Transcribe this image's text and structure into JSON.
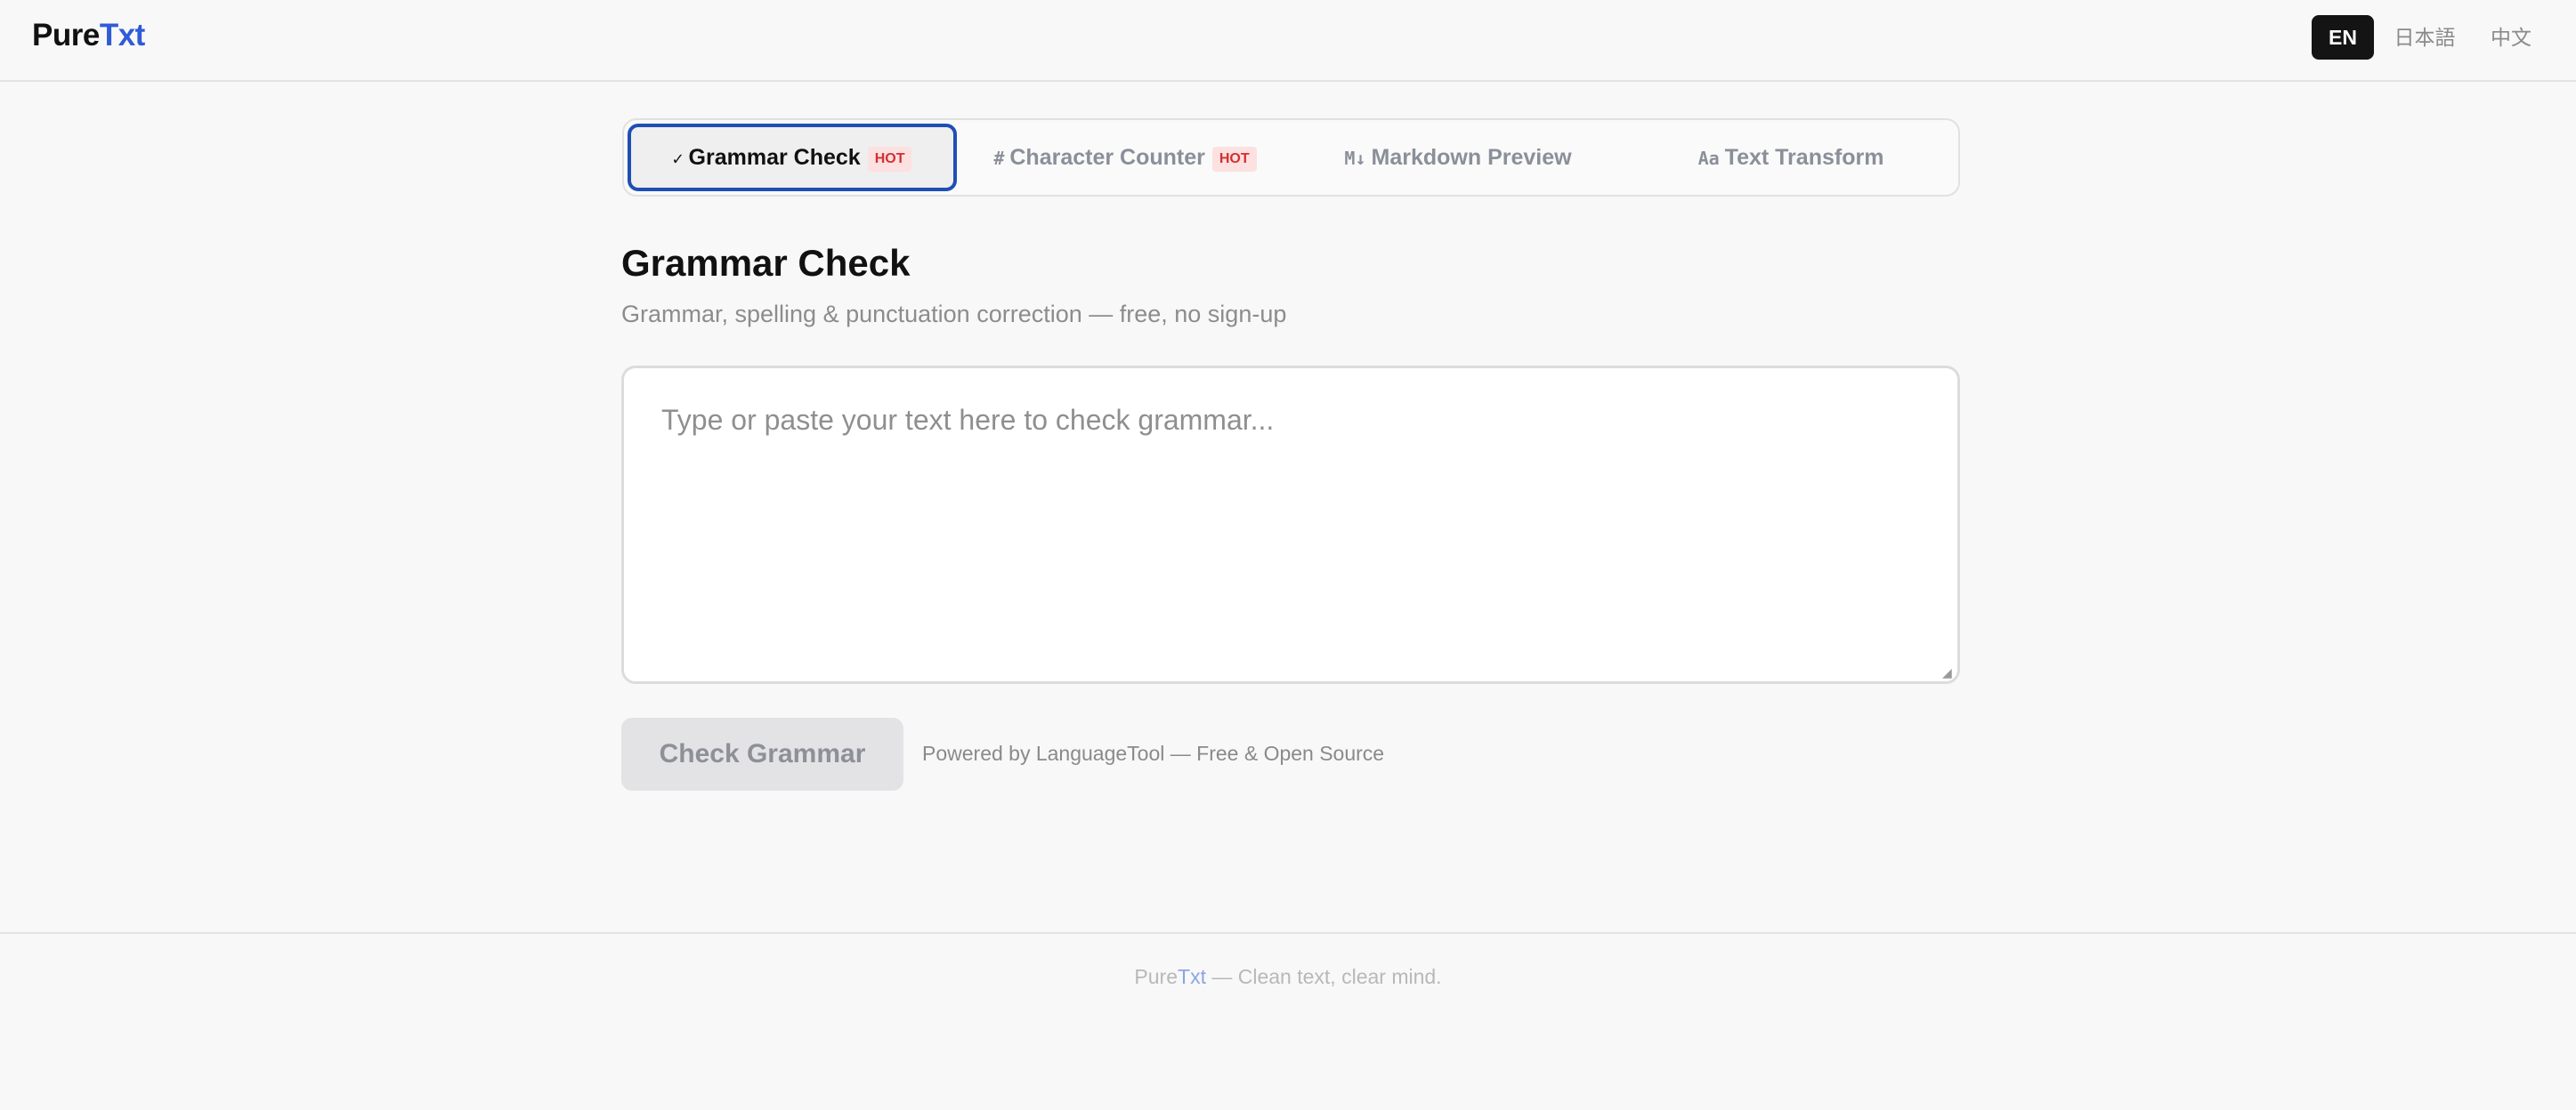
{
  "brand": {
    "part1": "Pure",
    "part2": "Txt"
  },
  "languages": [
    {
      "label": "EN",
      "active": true
    },
    {
      "label": "日本語",
      "active": false
    },
    {
      "label": "中文",
      "active": false
    }
  ],
  "tabs": [
    {
      "glyph": "✓",
      "label": "Grammar Check",
      "badge": "HOT",
      "active": true
    },
    {
      "glyph": "#",
      "label": "Character Counter",
      "badge": "HOT",
      "active": false
    },
    {
      "glyph": "M↓",
      "label": "Markdown Preview",
      "active": false
    },
    {
      "glyph": "Aa",
      "label": "Text Transform",
      "active": false
    }
  ],
  "page": {
    "title": "Grammar Check",
    "subtitle": "Grammar, spelling & punctuation correction — free, no sign-up"
  },
  "editor": {
    "placeholder": "Type or paste your text here to check grammar...",
    "value": ""
  },
  "actions": {
    "check_label": "Check Grammar",
    "powered_by": "Powered by LanguageTool — Free & Open Source"
  },
  "footer": {
    "brand1": "Pure",
    "brand2": "Txt",
    "tagline": " — Clean text, clear mind."
  },
  "colors": {
    "accent": "#2f5bd8",
    "active_tab_border": "#1f4fb5",
    "badge_bg": "#fde0e0",
    "badge_text": "#d33030"
  }
}
